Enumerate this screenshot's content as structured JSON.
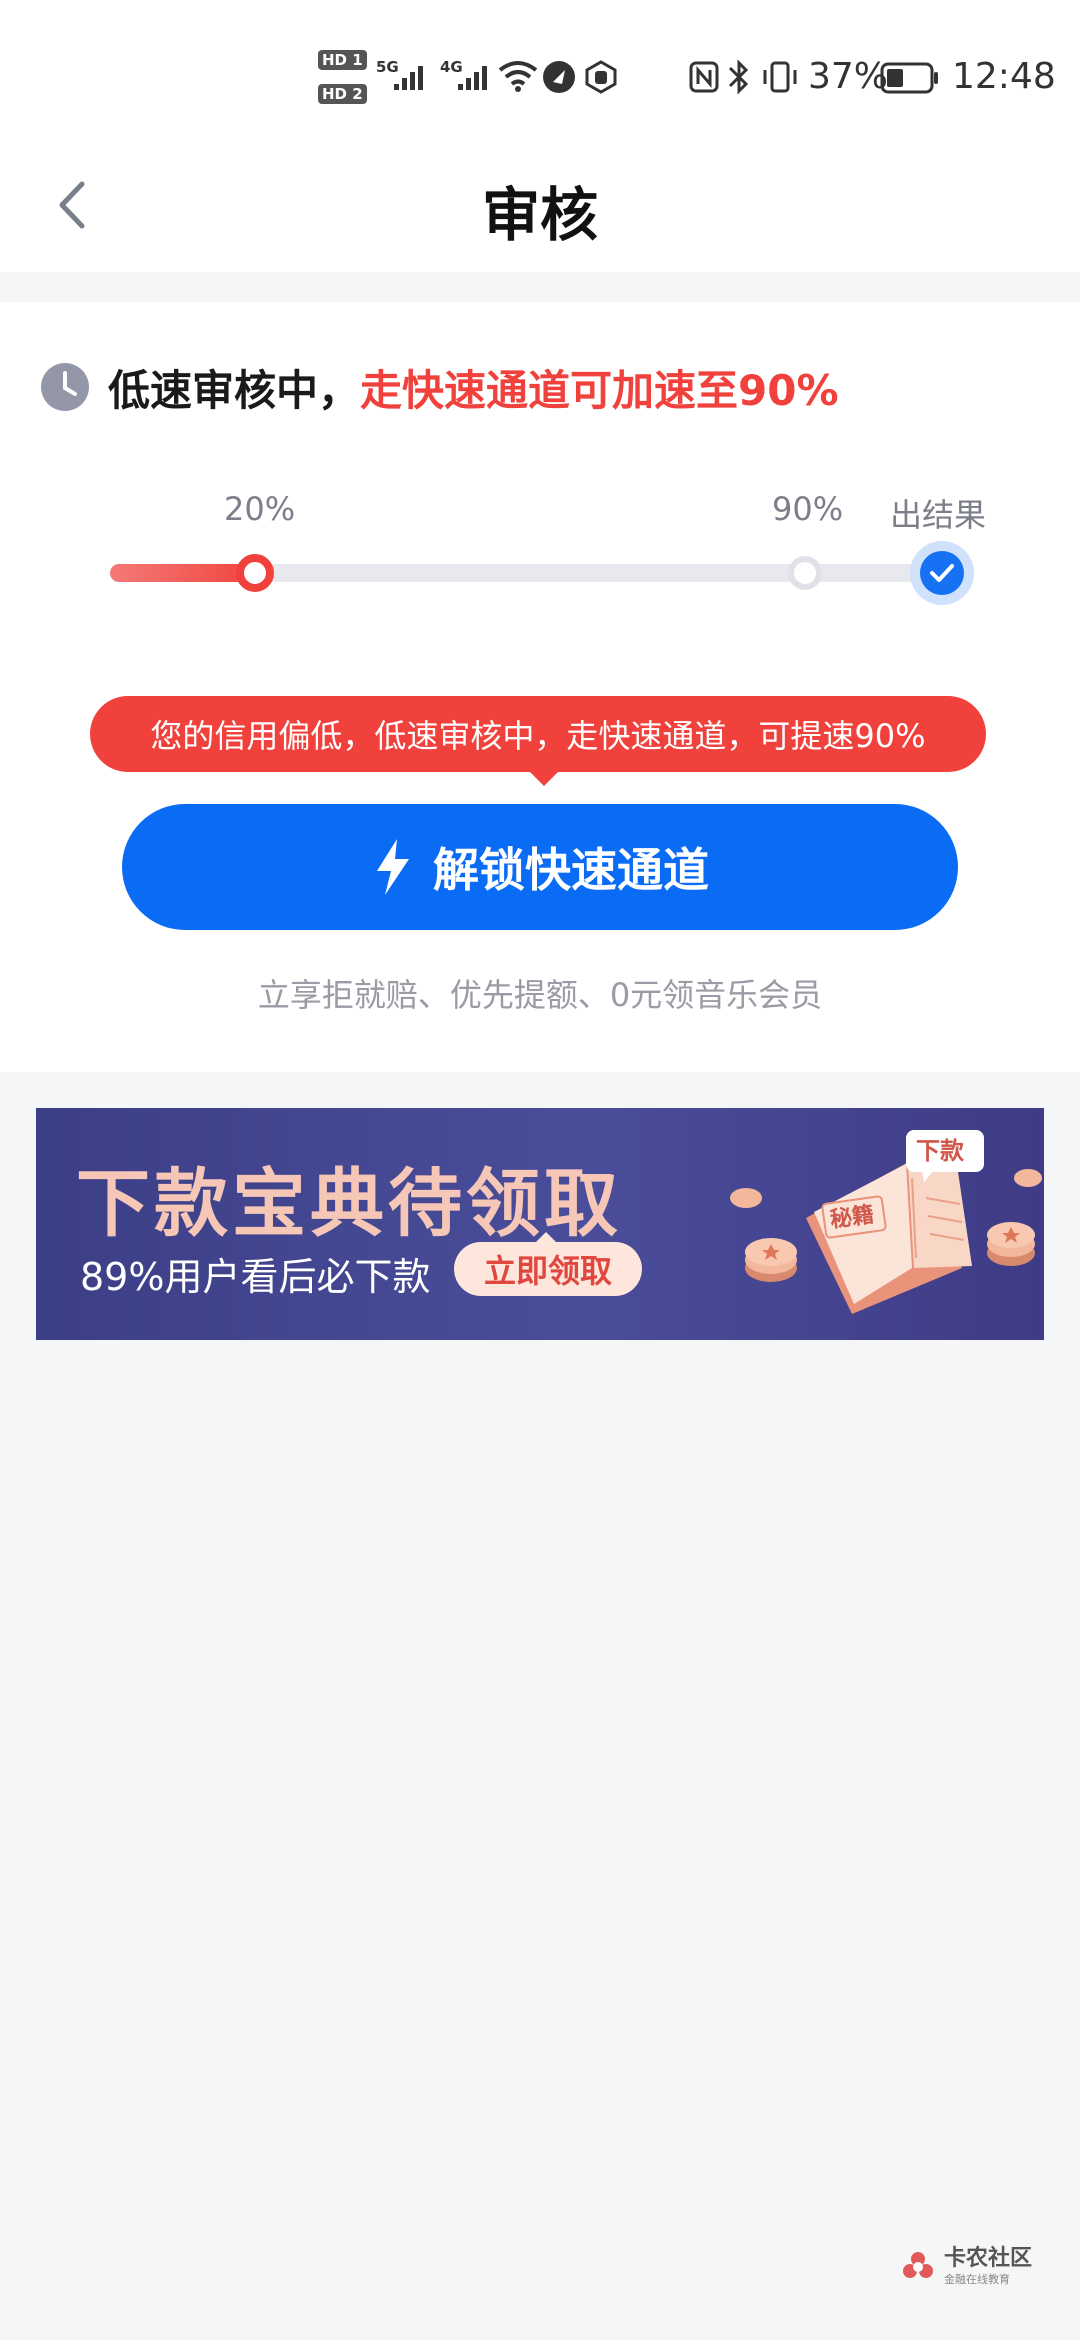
{
  "status_bar": {
    "sim1": "HD 1",
    "sim2": "HD 2",
    "net1": "5G",
    "net2": "4G",
    "battery": "37%",
    "time": "12:48"
  },
  "header": {
    "title": "审核"
  },
  "review": {
    "status_text": "低速审核中，",
    "status_highlight": "走快速通道可加速至90%",
    "progress": {
      "current_percent": 20,
      "stage1_label": "20%",
      "stage2_label": "90%",
      "stage3_label": "出结果"
    },
    "tooltip": "您的信用偏低，低速审核中，走快速通道，可提速90%",
    "cta_label": "解锁快速通道",
    "benefits": "立享拒就赔、优先提额、0元领音乐会员"
  },
  "banner": {
    "title": "下款宝典待领取",
    "subtitle": "89%用户看后必下款",
    "button": "立即领取",
    "book_left": "秘籍",
    "book_right": "下款"
  },
  "watermark": {
    "main": "卡农社区",
    "sub": "金融在线教育"
  },
  "colors": {
    "accent_blue": "#0a6cf5",
    "alert_red": "#f0413c",
    "banner_bg": "#3c3f86"
  }
}
